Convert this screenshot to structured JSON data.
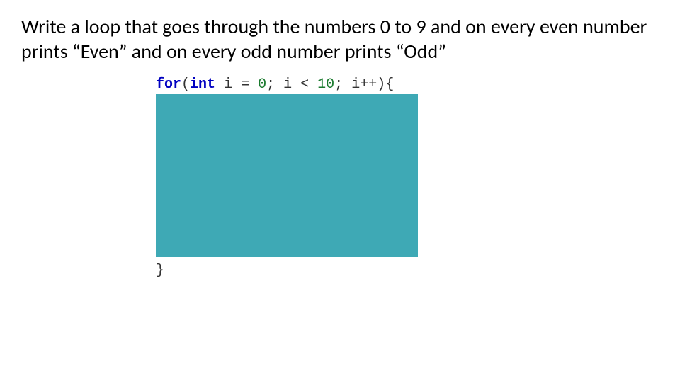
{
  "prompt": "Write a loop that goes through the numbers 0 to 9 and on every even number prints “Even” and on every odd number prints “Odd”",
  "code": {
    "kw_for": "for",
    "paren_open": "(",
    "type_int": "int",
    "var_decl": " i ",
    "eq": "=",
    "sp1": " ",
    "zero": "0",
    "semi1": "; ",
    "cond_lhs": "i ",
    "lt": "<",
    "sp2": " ",
    "ten": "10",
    "semi2": "; ",
    "inc": "i++",
    "paren_close": ")",
    "brace_open": "{",
    "brace_close": "}"
  }
}
